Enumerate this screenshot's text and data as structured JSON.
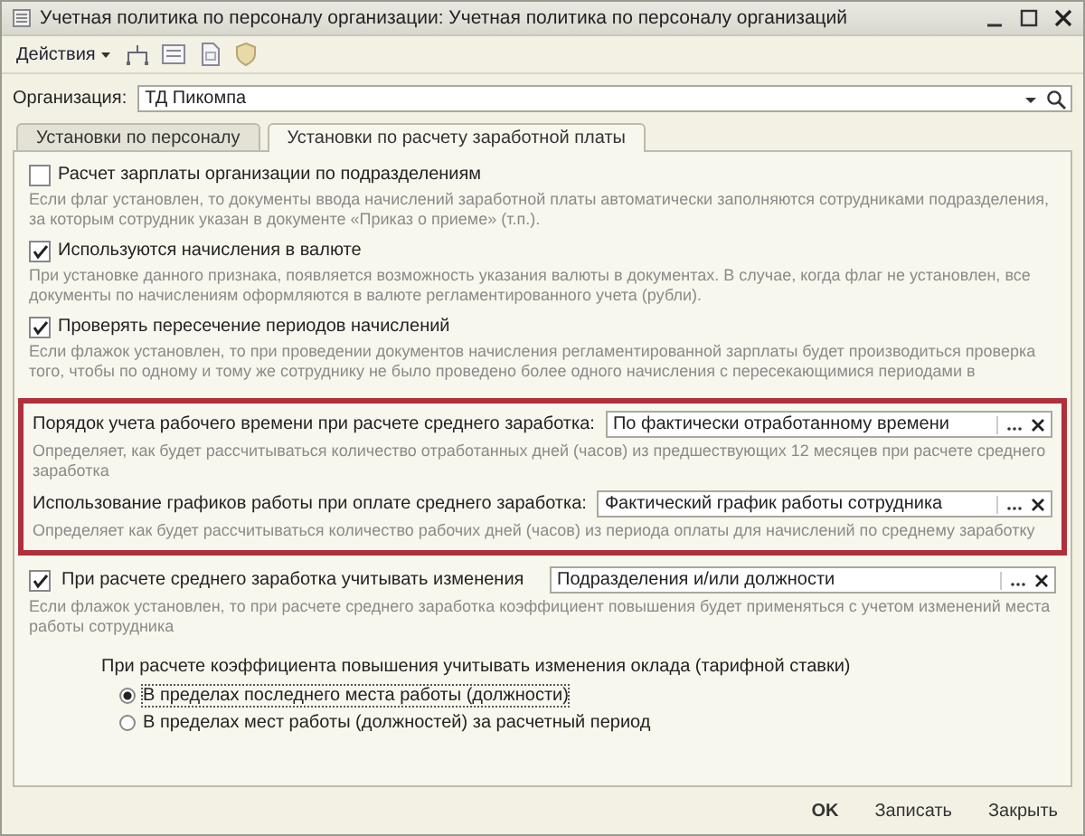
{
  "window": {
    "title": "Учетная политика по персоналу организации: Учетная политика по персоналу организаций"
  },
  "toolbar": {
    "actions_menu": "Действия"
  },
  "organization": {
    "label": "Организация:",
    "value": "ТД Пикомпа"
  },
  "tabs": [
    {
      "label": "Установки по персоналу",
      "selected": false
    },
    {
      "label": "Установки по расчету заработной платы",
      "selected": true
    }
  ],
  "sections": [
    {
      "kind": "checkbox",
      "label": "Расчет зарплаты организации по подразделениям",
      "checked": false,
      "hint": "Если флаг установлен, то документы ввода начислений заработной платы автоматически заполняются сотрудниками подразделения, за которым сотрудник указан в документе «Приказ о приеме» (т.п.)."
    },
    {
      "kind": "checkbox",
      "label": "Используются начисления в валюте",
      "checked": true,
      "hint": "При установке данного признака, появляется возможность указания валюты в документах. В случае, когда флаг не установлен, все документы по начислениям оформляются в валюте регламентированного учета (рубли)."
    },
    {
      "kind": "checkbox",
      "label": "Проверять пересечение периодов начислений",
      "checked": true,
      "hint": "Если флажок установлен, то при проведении документов начисления регламентированной зарплаты будет производиться проверка того, чтобы по одному и тому же сотруднику не было проведено более одного начисления с пересекающимися периодами в"
    },
    {
      "kind": "highlight",
      "items": [
        {
          "label": "Порядок учета рабочего времени при расчете среднего заработка:",
          "value": "По фактически отработанному времени",
          "hint": "Определяет, как будет рассчитываться количество отработанных дней (часов) из предшествующих 12 месяцев при расчете среднего заработка"
        },
        {
          "label": "Использование графиков работы при оплате среднего заработка:",
          "value": "Фактический график работы сотрудника",
          "hint": "Определяет как будет рассчитываться количество рабочих дней (часов) из периода оплаты для начислений по среднему заработку"
        }
      ]
    },
    {
      "kind": "checkbox_select",
      "label": "При расчете среднего заработка учитывать изменения",
      "checked": true,
      "value": "Подразделения и/или должности",
      "hint": "Если флажок установлен, то при расчете среднего заработка коэффициент повышения будет применяться с учетом изменений места работы сотрудника"
    },
    {
      "kind": "radio_group",
      "label": "При расчете коэффициента повышения учитывать изменения оклада (тарифной ставки)",
      "options": [
        {
          "label": "В пределах последнего места работы (должности)",
          "selected": true
        },
        {
          "label": "В пределах мест работы (должностей) за расчетный период",
          "selected": false
        }
      ]
    }
  ],
  "buttons": [
    "OK",
    "Записать",
    "Закрыть"
  ]
}
